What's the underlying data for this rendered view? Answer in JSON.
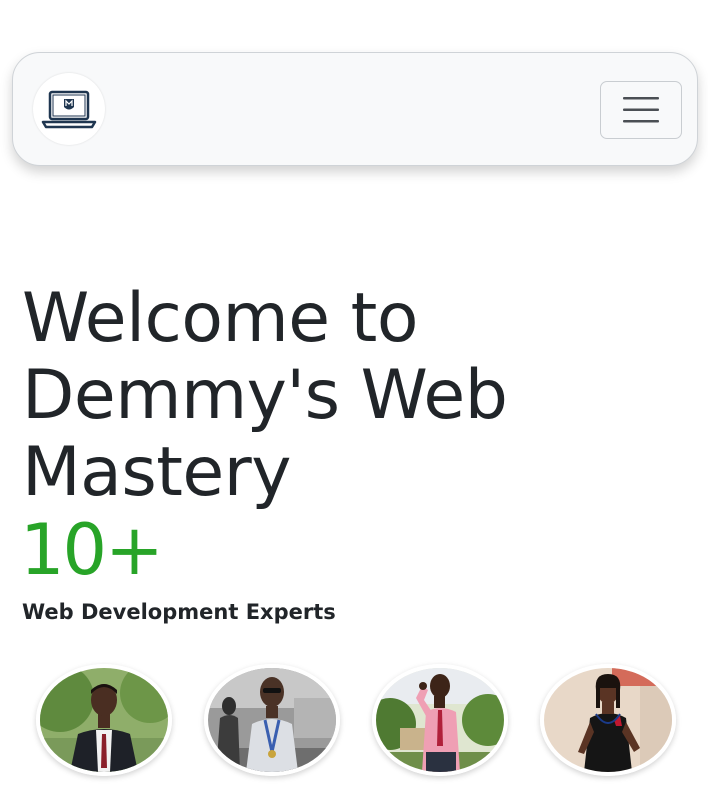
{
  "navbar": {
    "logo_icon": "laptop-logo-icon",
    "toggler_icon": "hamburger-menu-icon"
  },
  "hero": {
    "title_lines": [
      "Welcome to",
      "Demmy's Web",
      "Mastery"
    ],
    "stat_number": "10+",
    "stat_label": "Web Development Experts"
  },
  "team": [
    {
      "photo": "team-member-photo-1"
    },
    {
      "photo": "team-member-photo-2"
    },
    {
      "photo": "team-member-photo-3"
    },
    {
      "photo": "team-member-photo-4"
    }
  ],
  "colors": {
    "accent_green": "#28a428",
    "text_dark": "#212529",
    "navbar_bg": "#f8f9fa"
  }
}
